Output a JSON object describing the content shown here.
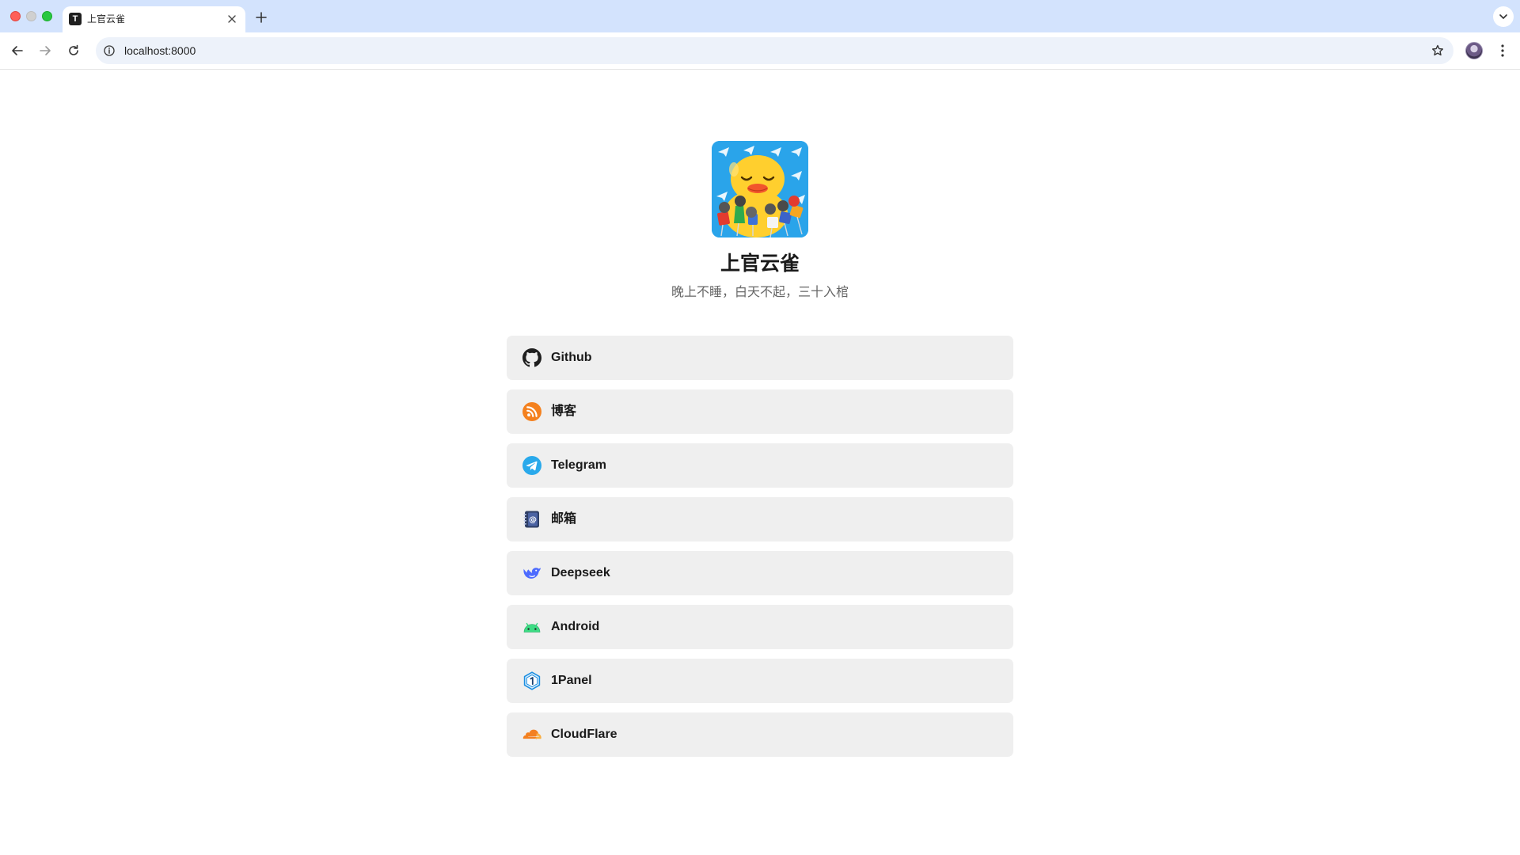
{
  "browser": {
    "tab_title": "上官云雀",
    "tab_favicon_letter": "T",
    "url": "localhost:8000"
  },
  "profile": {
    "name": "上官云雀",
    "bio": "晚上不睡，白天不起，三十入棺"
  },
  "links": [
    {
      "label": "Github",
      "icon": "github-icon"
    },
    {
      "label": "博客",
      "icon": "rss-icon"
    },
    {
      "label": "Telegram",
      "icon": "telegram-icon"
    },
    {
      "label": "邮箱",
      "icon": "address-book-icon"
    },
    {
      "label": "Deepseek",
      "icon": "deepseek-whale-icon"
    },
    {
      "label": "Android",
      "icon": "android-icon"
    },
    {
      "label": "1Panel",
      "icon": "1panel-icon"
    },
    {
      "label": "CloudFlare",
      "icon": "cloudflare-icon"
    }
  ],
  "colors": {
    "tabbar_bg": "#d3e3fd",
    "card_bg": "#efefef",
    "rss_orange": "#f4811f",
    "telegram_blue": "#29a9eb",
    "deepseek_blue": "#4d6bfe",
    "android_green": "#3ddc84",
    "cloudflare_orange": "#f38020"
  }
}
